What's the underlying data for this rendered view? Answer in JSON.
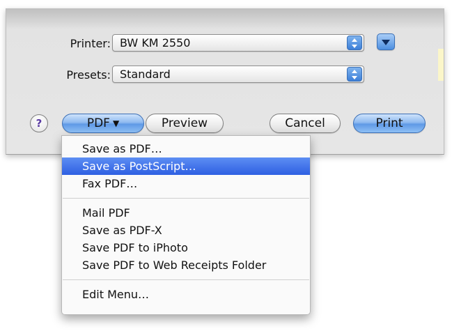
{
  "dialog": {
    "printer_label": "Printer:",
    "printer_value": "BW KM 2550",
    "presets_label": "Presets:",
    "presets_value": "Standard"
  },
  "buttons": {
    "help": "?",
    "pdf": "PDF",
    "preview": "Preview",
    "cancel": "Cancel",
    "print": "Print"
  },
  "pdf_menu": {
    "group1": [
      "Save as PDF…",
      "Save as PostScript…",
      "Fax PDF…"
    ],
    "group2": [
      "Mail PDF",
      "Save as PDF-X",
      "Save PDF to iPhoto",
      "Save PDF to Web Receipts Folder"
    ],
    "group3": [
      "Edit Menu…"
    ],
    "selected": "Save as PostScript…"
  },
  "colors": {
    "accent": "#3c7fd8",
    "highlight": "#2e5fe2",
    "help_glyph": "#5a3aa3"
  },
  "icons": {
    "popup_arrows": "updown-arrows-icon",
    "disclosure": "chevron-down-icon",
    "pdf_menu_indicator": "triangle-down-icon"
  }
}
